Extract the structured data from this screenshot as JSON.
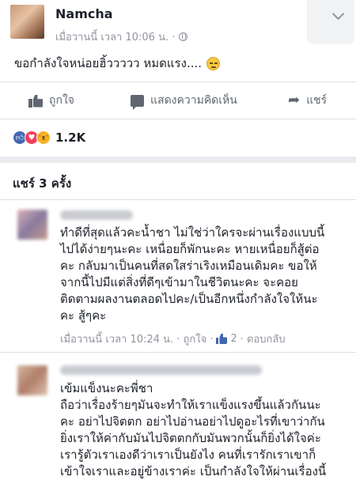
{
  "post": {
    "author": "Namcha",
    "time": "เมื่อวานนี้ เวลา 10:06 น. ·",
    "text": "ขอกำลังใจหน่อยฮิ้ววววว หมดแรง....",
    "privacy_icon": "globe-icon",
    "menu_icon": "chevron-down-icon"
  },
  "actions": {
    "like": "ถูกใจ",
    "comment": "แสดงความคิดเห็น",
    "share": "แชร์"
  },
  "reactions": {
    "count": "1.2K",
    "types": [
      "like",
      "love",
      "haha"
    ]
  },
  "shares": {
    "title": "แชร์ 3 ครั้ง"
  },
  "comments": [
    {
      "lines": [
        "ทำดีที่สุดแล้วคะน้ำชา ไม่ใช่ว่าใครจะผ่านเรื่องแบบนี้",
        "ไปได้ง่ายๆนะคะ  เหนื่อยก็พักนะคะ หายเหนื่อยก็สู้ต่อ",
        "คะ กลับมาเป็นคนที่สดใสร่าเริงเหมือนเดิมคะ ขอให้",
        "จากนี้ไปมีแต่สิ่งที่ดีๆเข้ามาในชีวิตนะคะ จะคอย",
        "ติดตามผลงานตลอดไปคะ/เป็นอีกหนึ่งกำลังใจให้นะ",
        "คะ สู้ๆคะ"
      ],
      "time": "เมื่อวานนี้ เวลา 10:24 น. · ถูกใจ ·",
      "likes": "2",
      "reply": "· ตอบกลับ"
    },
    {
      "lines": [
        "เข้มแข็งนะคะพี่ชา",
        "ถือว่าเรื่องร้ายๆมันจะทำให้เราแข็งแรงขึ้นแล้วกันนะ",
        "คะ อย่าไปจิตตก อย่าไปอ่านอย่าไปดูอะไรที่เขาว่ากัน",
        "ยิ่งเราให้ค่ากับมันไปจิตตกกับมันพวกนั้นก็ยิ่งได้ใจค่ะ",
        "เรารู้ตัวเราเองดีว่าเราเป็นยังไง คนที่เรารักเราเขาก็",
        "เข้าใจเราและอยู่ข้างเราค่ะ เป็นกำลังใจให้ผ่านเรื่องนี้"
      ]
    }
  ]
}
